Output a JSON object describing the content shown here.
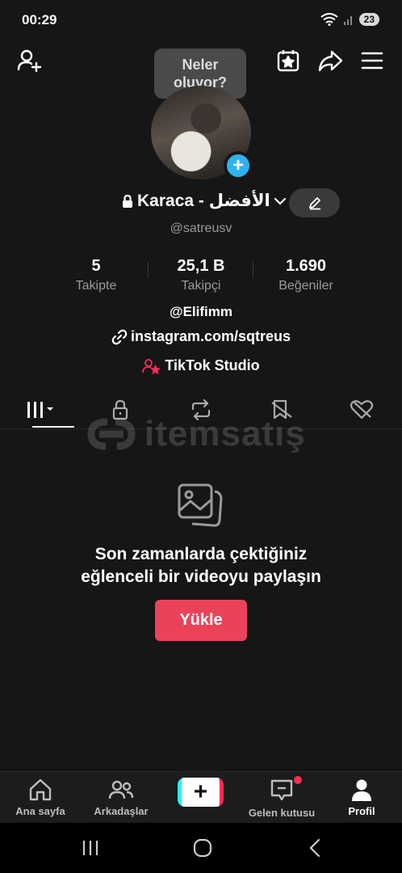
{
  "status_bar": {
    "time": "00:29",
    "battery": "23"
  },
  "header": {
    "tooltip_line1": "Neler",
    "tooltip_line2": "oluyor?"
  },
  "profile": {
    "display_name": "Karaca - الأفضل",
    "username": "@satreusv",
    "stats": [
      {
        "value": "5",
        "label": "Takipte"
      },
      {
        "value": "25,1 B",
        "label": "Takipçi"
      },
      {
        "value": "1.690",
        "label": "Beğeniler"
      }
    ],
    "bio": "@Elifimm",
    "link": "instagram.com/sqtreus",
    "studio": "TikTok Studio"
  },
  "watermark": {
    "text": "itemsatış"
  },
  "empty_state": {
    "line1": "Son zamanlarda çektiğiniz",
    "line2": "eğlenceli bir videoyu paylaşın",
    "button": "Yükle"
  },
  "bottom_nav": {
    "home": "Ana sayfa",
    "friends": "Arkadaşlar",
    "inbox": "Gelen kutusu",
    "profile": "Profil"
  },
  "colors": {
    "accent": "#ea4359",
    "avatar_plus": "#2db4ef",
    "notification_dot": "#fe2c55"
  }
}
